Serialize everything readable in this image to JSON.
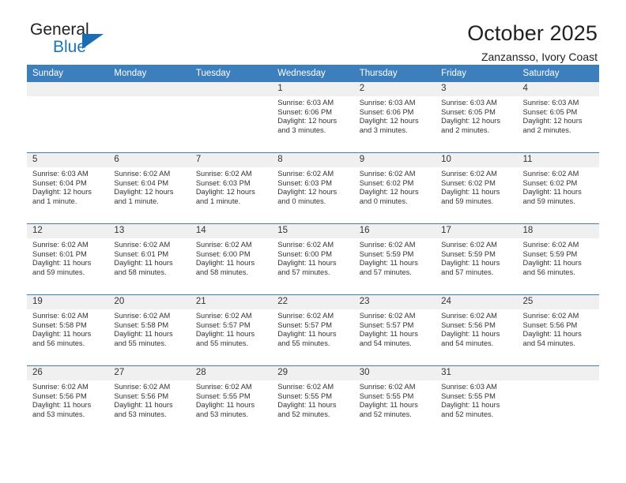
{
  "logo": {
    "word1": "General",
    "word2": "Blue",
    "triangle_color": "#1b6cb3",
    "word2_color": "#1b75bb"
  },
  "header": {
    "title": "October 2025",
    "location": "Zanzansso, Ivory Coast"
  },
  "theme": {
    "header_bg": "#3d7ebd",
    "daynum_bg": "#f0f0f0",
    "grid_line": "#3d7ebd",
    "text": "#333333"
  },
  "weekday_headers": [
    "Sunday",
    "Monday",
    "Tuesday",
    "Wednesday",
    "Thursday",
    "Friday",
    "Saturday"
  ],
  "weeks": [
    [
      {
        "day": "",
        "sunrise": "",
        "sunset": "",
        "daylight1": "",
        "daylight2": ""
      },
      {
        "day": "",
        "sunrise": "",
        "sunset": "",
        "daylight1": "",
        "daylight2": ""
      },
      {
        "day": "",
        "sunrise": "",
        "sunset": "",
        "daylight1": "",
        "daylight2": ""
      },
      {
        "day": "1",
        "sunrise": "Sunrise: 6:03 AM",
        "sunset": "Sunset: 6:06 PM",
        "daylight1": "Daylight: 12 hours",
        "daylight2": "and 3 minutes."
      },
      {
        "day": "2",
        "sunrise": "Sunrise: 6:03 AM",
        "sunset": "Sunset: 6:06 PM",
        "daylight1": "Daylight: 12 hours",
        "daylight2": "and 3 minutes."
      },
      {
        "day": "3",
        "sunrise": "Sunrise: 6:03 AM",
        "sunset": "Sunset: 6:05 PM",
        "daylight1": "Daylight: 12 hours",
        "daylight2": "and 2 minutes."
      },
      {
        "day": "4",
        "sunrise": "Sunrise: 6:03 AM",
        "sunset": "Sunset: 6:05 PM",
        "daylight1": "Daylight: 12 hours",
        "daylight2": "and 2 minutes."
      }
    ],
    [
      {
        "day": "5",
        "sunrise": "Sunrise: 6:03 AM",
        "sunset": "Sunset: 6:04 PM",
        "daylight1": "Daylight: 12 hours",
        "daylight2": "and 1 minute."
      },
      {
        "day": "6",
        "sunrise": "Sunrise: 6:02 AM",
        "sunset": "Sunset: 6:04 PM",
        "daylight1": "Daylight: 12 hours",
        "daylight2": "and 1 minute."
      },
      {
        "day": "7",
        "sunrise": "Sunrise: 6:02 AM",
        "sunset": "Sunset: 6:03 PM",
        "daylight1": "Daylight: 12 hours",
        "daylight2": "and 1 minute."
      },
      {
        "day": "8",
        "sunrise": "Sunrise: 6:02 AM",
        "sunset": "Sunset: 6:03 PM",
        "daylight1": "Daylight: 12 hours",
        "daylight2": "and 0 minutes."
      },
      {
        "day": "9",
        "sunrise": "Sunrise: 6:02 AM",
        "sunset": "Sunset: 6:02 PM",
        "daylight1": "Daylight: 12 hours",
        "daylight2": "and 0 minutes."
      },
      {
        "day": "10",
        "sunrise": "Sunrise: 6:02 AM",
        "sunset": "Sunset: 6:02 PM",
        "daylight1": "Daylight: 11 hours",
        "daylight2": "and 59 minutes."
      },
      {
        "day": "11",
        "sunrise": "Sunrise: 6:02 AM",
        "sunset": "Sunset: 6:02 PM",
        "daylight1": "Daylight: 11 hours",
        "daylight2": "and 59 minutes."
      }
    ],
    [
      {
        "day": "12",
        "sunrise": "Sunrise: 6:02 AM",
        "sunset": "Sunset: 6:01 PM",
        "daylight1": "Daylight: 11 hours",
        "daylight2": "and 59 minutes."
      },
      {
        "day": "13",
        "sunrise": "Sunrise: 6:02 AM",
        "sunset": "Sunset: 6:01 PM",
        "daylight1": "Daylight: 11 hours",
        "daylight2": "and 58 minutes."
      },
      {
        "day": "14",
        "sunrise": "Sunrise: 6:02 AM",
        "sunset": "Sunset: 6:00 PM",
        "daylight1": "Daylight: 11 hours",
        "daylight2": "and 58 minutes."
      },
      {
        "day": "15",
        "sunrise": "Sunrise: 6:02 AM",
        "sunset": "Sunset: 6:00 PM",
        "daylight1": "Daylight: 11 hours",
        "daylight2": "and 57 minutes."
      },
      {
        "day": "16",
        "sunrise": "Sunrise: 6:02 AM",
        "sunset": "Sunset: 5:59 PM",
        "daylight1": "Daylight: 11 hours",
        "daylight2": "and 57 minutes."
      },
      {
        "day": "17",
        "sunrise": "Sunrise: 6:02 AM",
        "sunset": "Sunset: 5:59 PM",
        "daylight1": "Daylight: 11 hours",
        "daylight2": "and 57 minutes."
      },
      {
        "day": "18",
        "sunrise": "Sunrise: 6:02 AM",
        "sunset": "Sunset: 5:59 PM",
        "daylight1": "Daylight: 11 hours",
        "daylight2": "and 56 minutes."
      }
    ],
    [
      {
        "day": "19",
        "sunrise": "Sunrise: 6:02 AM",
        "sunset": "Sunset: 5:58 PM",
        "daylight1": "Daylight: 11 hours",
        "daylight2": "and 56 minutes."
      },
      {
        "day": "20",
        "sunrise": "Sunrise: 6:02 AM",
        "sunset": "Sunset: 5:58 PM",
        "daylight1": "Daylight: 11 hours",
        "daylight2": "and 55 minutes."
      },
      {
        "day": "21",
        "sunrise": "Sunrise: 6:02 AM",
        "sunset": "Sunset: 5:57 PM",
        "daylight1": "Daylight: 11 hours",
        "daylight2": "and 55 minutes."
      },
      {
        "day": "22",
        "sunrise": "Sunrise: 6:02 AM",
        "sunset": "Sunset: 5:57 PM",
        "daylight1": "Daylight: 11 hours",
        "daylight2": "and 55 minutes."
      },
      {
        "day": "23",
        "sunrise": "Sunrise: 6:02 AM",
        "sunset": "Sunset: 5:57 PM",
        "daylight1": "Daylight: 11 hours",
        "daylight2": "and 54 minutes."
      },
      {
        "day": "24",
        "sunrise": "Sunrise: 6:02 AM",
        "sunset": "Sunset: 5:56 PM",
        "daylight1": "Daylight: 11 hours",
        "daylight2": "and 54 minutes."
      },
      {
        "day": "25",
        "sunrise": "Sunrise: 6:02 AM",
        "sunset": "Sunset: 5:56 PM",
        "daylight1": "Daylight: 11 hours",
        "daylight2": "and 54 minutes."
      }
    ],
    [
      {
        "day": "26",
        "sunrise": "Sunrise: 6:02 AM",
        "sunset": "Sunset: 5:56 PM",
        "daylight1": "Daylight: 11 hours",
        "daylight2": "and 53 minutes."
      },
      {
        "day": "27",
        "sunrise": "Sunrise: 6:02 AM",
        "sunset": "Sunset: 5:56 PM",
        "daylight1": "Daylight: 11 hours",
        "daylight2": "and 53 minutes."
      },
      {
        "day": "28",
        "sunrise": "Sunrise: 6:02 AM",
        "sunset": "Sunset: 5:55 PM",
        "daylight1": "Daylight: 11 hours",
        "daylight2": "and 53 minutes."
      },
      {
        "day": "29",
        "sunrise": "Sunrise: 6:02 AM",
        "sunset": "Sunset: 5:55 PM",
        "daylight1": "Daylight: 11 hours",
        "daylight2": "and 52 minutes."
      },
      {
        "day": "30",
        "sunrise": "Sunrise: 6:02 AM",
        "sunset": "Sunset: 5:55 PM",
        "daylight1": "Daylight: 11 hours",
        "daylight2": "and 52 minutes."
      },
      {
        "day": "31",
        "sunrise": "Sunrise: 6:03 AM",
        "sunset": "Sunset: 5:55 PM",
        "daylight1": "Daylight: 11 hours",
        "daylight2": "and 52 minutes."
      },
      {
        "day": "",
        "sunrise": "",
        "sunset": "",
        "daylight1": "",
        "daylight2": ""
      }
    ]
  ]
}
